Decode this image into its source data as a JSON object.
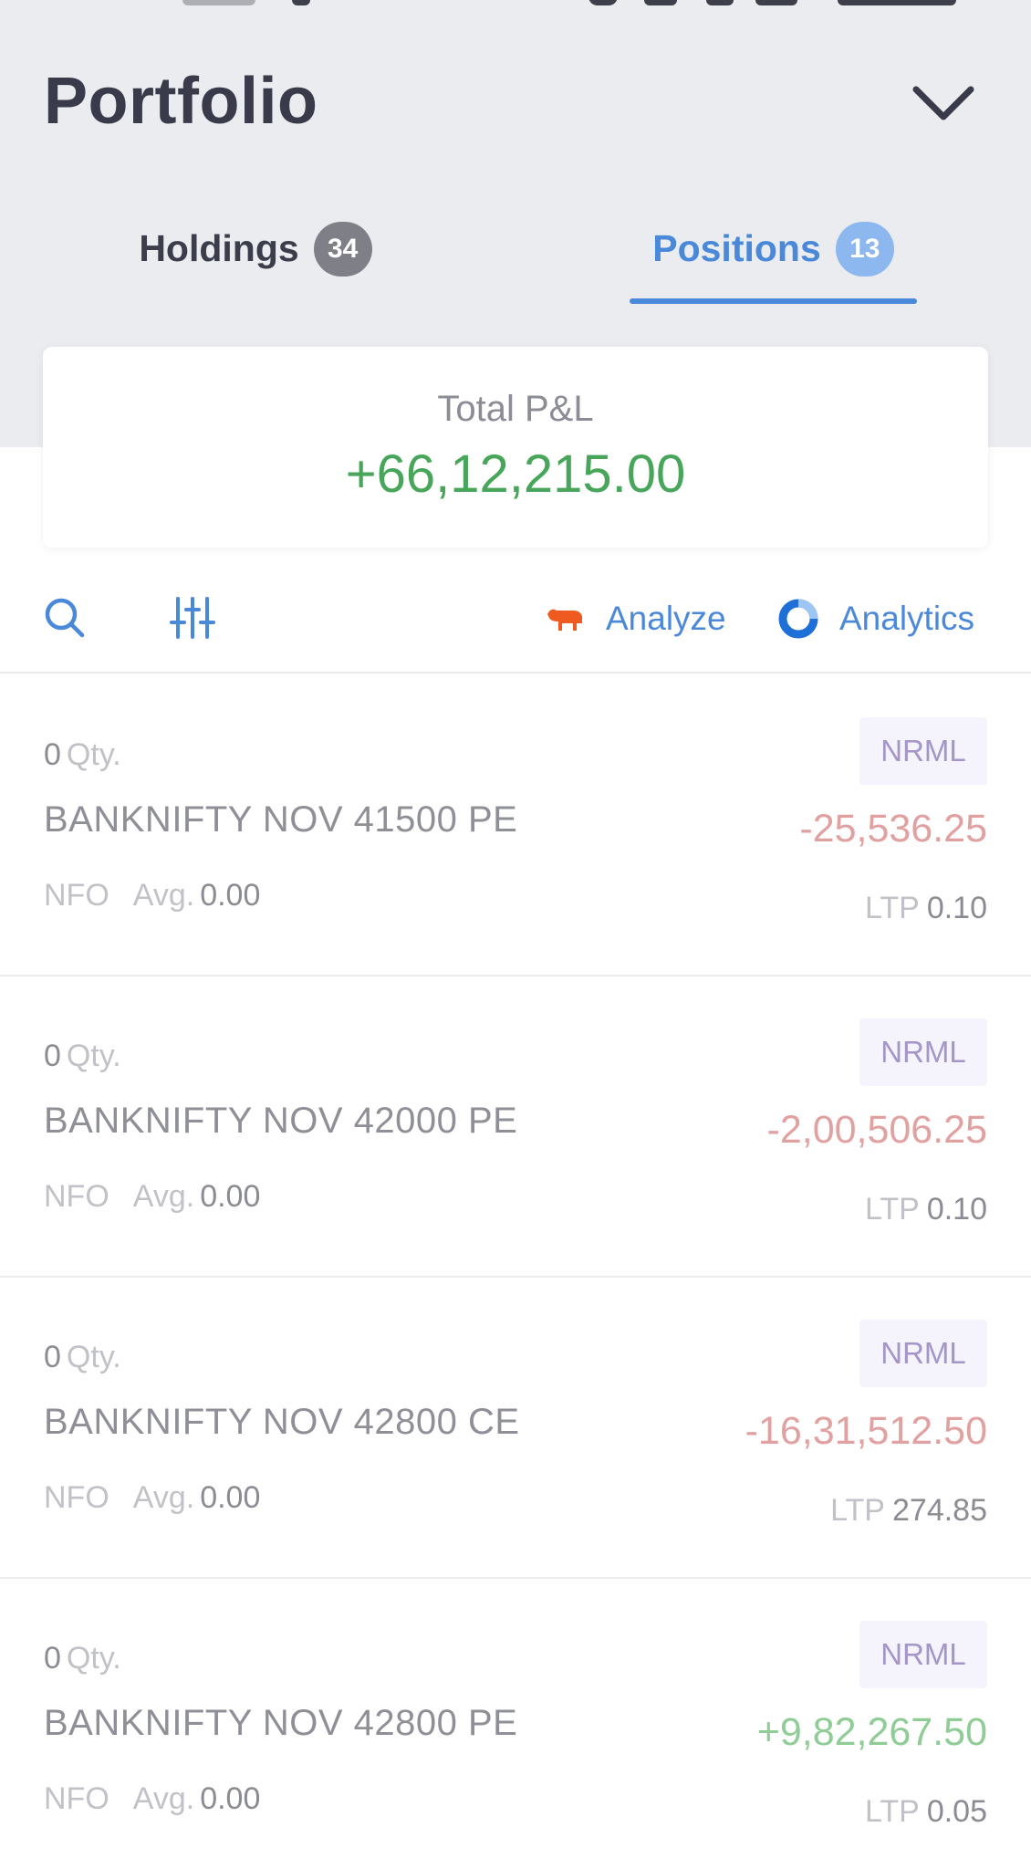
{
  "header": {
    "title": "Portfolio",
    "menu_icon": "chevron-down-icon"
  },
  "tabs": [
    {
      "label": "Holdings",
      "count": "34",
      "active": false
    },
    {
      "label": "Positions",
      "count": "13",
      "active": true
    }
  ],
  "summary": {
    "label": "Total P&L",
    "value": "+66,12,215.00"
  },
  "toolbar": {
    "search_icon": "search-icon",
    "filter_icon": "sliders-icon",
    "analyze_label": "Analyze",
    "analytics_label": "Analytics"
  },
  "colors": {
    "accent": "#4a88da",
    "profit": "#47a65a",
    "loss_light": "#e2a1a1",
    "profit_light": "#8fcc96",
    "badge_text": "#a596c9",
    "analyze_icon": "#ee5a1f"
  },
  "positions": [
    {
      "qty": "0",
      "qty_label": "Qty.",
      "symbol": "BANKNIFTY NOV 41500 PE",
      "exchange": "NFO",
      "avg_label": "Avg.",
      "avg": "0.00",
      "product": "NRML",
      "pnl": "-25,536.25",
      "ltp_label": "LTP",
      "ltp": "0.10"
    },
    {
      "qty": "0",
      "qty_label": "Qty.",
      "symbol": "BANKNIFTY NOV 42000 PE",
      "exchange": "NFO",
      "avg_label": "Avg.",
      "avg": "0.00",
      "product": "NRML",
      "pnl": "-2,00,506.25",
      "ltp_label": "LTP",
      "ltp": "0.10"
    },
    {
      "qty": "0",
      "qty_label": "Qty.",
      "symbol": "BANKNIFTY NOV 42800 CE",
      "exchange": "NFO",
      "avg_label": "Avg.",
      "avg": "0.00",
      "product": "NRML",
      "pnl": "-16,31,512.50",
      "ltp_label": "LTP",
      "ltp": "274.85"
    },
    {
      "qty": "0",
      "qty_label": "Qty.",
      "symbol": "BANKNIFTY NOV 42800 PE",
      "exchange": "NFO",
      "avg_label": "Avg.",
      "avg": "0.00",
      "product": "NRML",
      "pnl": "+9,82,267.50",
      "ltp_label": "LTP",
      "ltp": "0.05"
    }
  ]
}
